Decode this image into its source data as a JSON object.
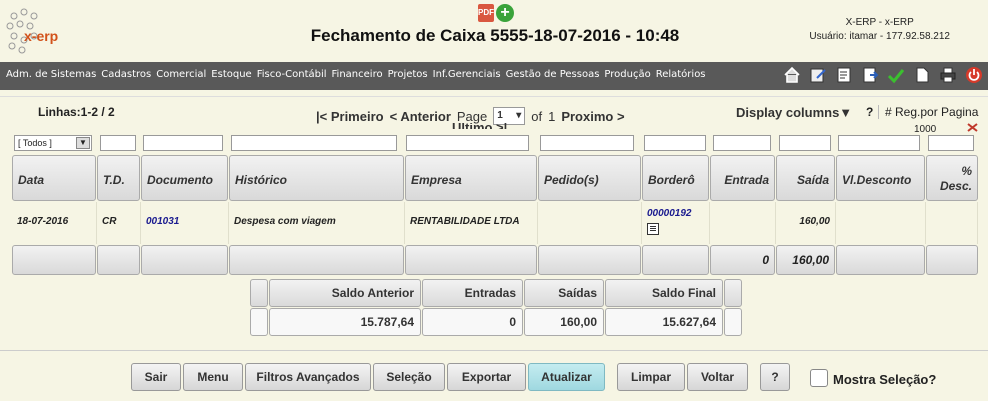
{
  "header": {
    "logo_text": "x-erp",
    "title": "Fechamento de Caixa 5555-18-07-2016 - 10:48",
    "system_name": "X-ERP - x-ERP",
    "user": "Usuário: itamar - 177.92.58.212"
  },
  "nav": {
    "items": [
      "Adm. de Sistemas",
      "Cadastros",
      "Comercial",
      "Estoque",
      "Fisco-Contábil",
      "Financeiro",
      "Projetos",
      "Inf.Gerenciais",
      "Gestão de Pessoas",
      "Produção",
      "Relatórios"
    ],
    "tools": [
      "home-icon",
      "edit-icon",
      "checklist-icon",
      "export-icon",
      "check-icon",
      "document-icon",
      "print-icon",
      "power-icon"
    ]
  },
  "pager": {
    "lines": "Linhas:1-2 / 2",
    "first": "|< Primeiro",
    "prev": "< Anterior",
    "page_label": "Page",
    "page_value": "1",
    "of": "of",
    "total": "1",
    "next": "Proximo >",
    "last": "Ultimo >|",
    "display_columns": "Display columns▼",
    "help": "?",
    "reg_label": "# Reg.por Pagina",
    "reg_value": "1000"
  },
  "filters": {
    "td_select": "[ Todos ]"
  },
  "table": {
    "headers": {
      "data": "Data",
      "td": "T.D.",
      "documento": "Documento",
      "historico": "Histórico",
      "empresa": "Empresa",
      "pedidos": "Pedido(s)",
      "bordero": "Borderô",
      "entrada": "Entrada",
      "saida": "Saída",
      "vl_desconto": "Vl.Desconto",
      "pct_desc": "% Desc."
    },
    "rows": [
      {
        "data": "18-07-2016",
        "td": "CR",
        "documento": "001031",
        "historico": "Despesa com viagem",
        "empresa": "RENTABILIDADE LTDA",
        "pedidos": "",
        "bordero": "00000192",
        "entrada": "",
        "saida": "160,00",
        "vl_desconto": "",
        "pct_desc": ""
      }
    ],
    "totals": {
      "entrada": "0",
      "saida": "160,00"
    }
  },
  "summary": {
    "labels": [
      "Saldo Anterior",
      "Entradas",
      "Saídas",
      "Saldo Final"
    ],
    "values": [
      "15.787,64",
      "0",
      "160,00",
      "15.627,64"
    ]
  },
  "buttons": {
    "sair": "Sair",
    "menu": "Menu",
    "filtros": "Filtros Avançados",
    "selecao": "Seleção",
    "exportar": "Exportar",
    "atualizar": "Atualizar",
    "limpar": "Limpar",
    "voltar": "Voltar",
    "help": "?",
    "mostra_selecao": "Mostra Seleção?"
  }
}
